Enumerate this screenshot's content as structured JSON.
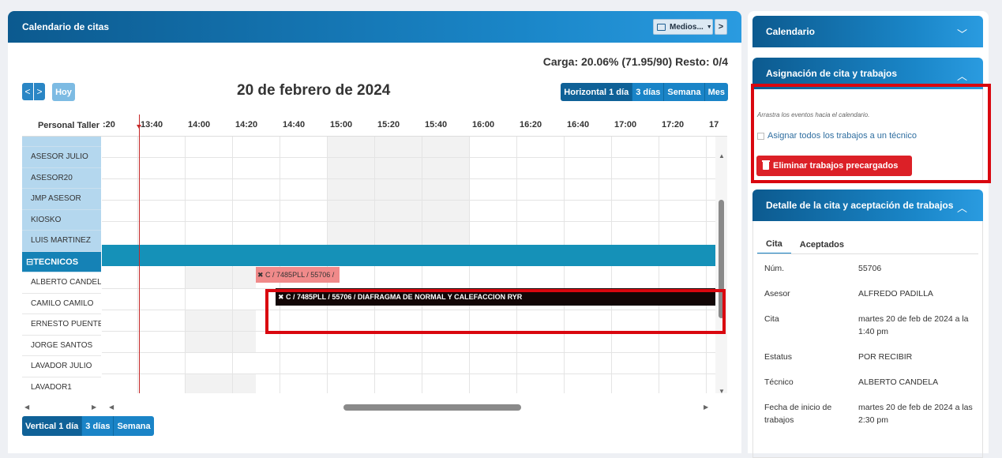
{
  "left": {
    "title": "Calendario de citas",
    "medios_label": "Medios...",
    "next_symbol": ">",
    "carga": "Carga: 20.06% (71.95/90) Resto: 0/4",
    "hoy_label": "Hoy",
    "date_title": "20 de febrero de 2024",
    "prev_arrow": "<",
    "next_arrow": ">",
    "views_top": [
      "Horizontal 1 día",
      "3 días",
      "Semana",
      "Mes"
    ],
    "views_bottom": [
      "Vertical 1 día",
      "3 días",
      "Semana"
    ]
  },
  "calendar": {
    "corner_label": "Personal Taller",
    "time_labels": [
      ":20",
      "13:40",
      "14:00",
      "14:20",
      "14:40",
      "15:00",
      "15:20",
      "15:40",
      "16:00",
      "16:20",
      "16:40",
      "17:00",
      "17:20",
      "17"
    ],
    "asesores": [
      "ASESOR JULIO",
      "ASESOR20",
      "JMP ASESOR",
      "KIOSKO",
      "LUIS MARTINEZ"
    ],
    "tecnicos_header": "⊟TECNICOS",
    "tecnicos": [
      "ALBERTO CANDELA",
      "CAMILO CAMILO",
      "ERNESTO PUENTE",
      "JORGE SANTOS",
      "LAVADOR JULIO",
      "LAVADOR1"
    ],
    "event_pink": "✖ C / 7485PLL / 55706 /",
    "event_black": "✖ C / 7485PLL / 55706 / DIAFRAGMA DE NORMAL Y CALEFACCION RYR"
  },
  "right": {
    "calendario_title": "Calendario",
    "asignacion_title": "Asignación de cita y trabajos",
    "drag_hint": "Arrastra los eventos hacia el calendario.",
    "assign_all_label": "Asignar todos los trabajos a un técnico",
    "delete_label": "Eliminar trabajos precargados",
    "detalle_title": "Detalle de la cita y aceptación de trabajos",
    "tabs": [
      "Cita",
      "Aceptados"
    ],
    "details": [
      {
        "label": "Núm.",
        "value": "55706"
      },
      {
        "label": "Asesor",
        "value": "ALFREDO PADILLA"
      },
      {
        "label": "Cita",
        "value": "martes 20 de feb de 2024 a la 1:40 pm"
      },
      {
        "label": "Estatus",
        "value": "POR RECIBIR"
      },
      {
        "label": "Técnico",
        "value": "ALBERTO CANDELA"
      },
      {
        "label": "Fecha de inicio de trabajos",
        "value": "martes 20 de feb de 2024 a las 2:30 pm"
      }
    ]
  },
  "icons": {
    "chevron_down": "chevron-down-icon",
    "chevron_up": "chevron-up-icon",
    "trash": "trash-icon",
    "media": "media-icon"
  },
  "colors": {
    "header_blue": "#1a84c7",
    "tecnicos_band": "#1591b8",
    "asesor_row": "#b4d7ee",
    "delete_red": "#dc2027",
    "highlight": "#d9070f"
  }
}
